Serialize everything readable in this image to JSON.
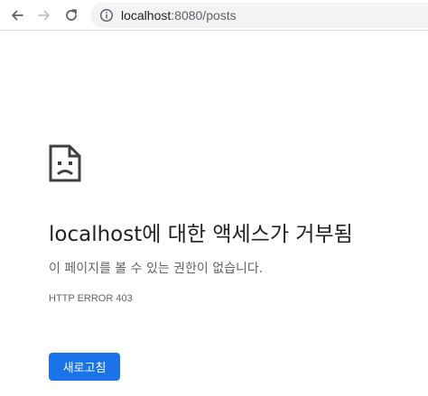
{
  "browser": {
    "url_host": "localhost",
    "url_path": ":8080/posts",
    "icons": {
      "back": "arrow-left-icon",
      "forward": "arrow-right-icon",
      "reload": "reload-icon",
      "info": "info-icon"
    }
  },
  "error_page": {
    "icon": "broken-document-icon",
    "title": "localhost에 대한 액세스가 거부됨",
    "description": "이 페이지를 볼 수 있는 권한이 없습니다.",
    "error_code": "HTTP ERROR 403",
    "reload_label": "새로고침"
  },
  "colors": {
    "accent": "#1a73e8",
    "text_primary": "#202124",
    "text_secondary": "#5f6368",
    "omnibox_bg": "#f1f3f4"
  }
}
